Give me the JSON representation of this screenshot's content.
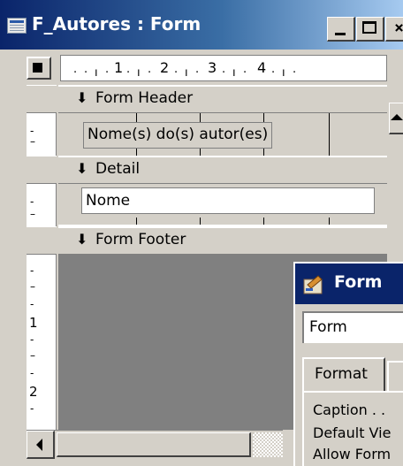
{
  "window": {
    "title": "F_Autores : Form",
    "buttons": {
      "minimize": "minimize-button",
      "maximize": "maximize-button",
      "close": "close-button"
    }
  },
  "ruler": {
    "numbers": [
      "1",
      "2",
      "3",
      "4"
    ]
  },
  "vertical_ruler": {
    "numbers": [
      "1",
      "2"
    ]
  },
  "sections": {
    "header": "Form Header",
    "detail": "Detail",
    "footer": "Form Footer"
  },
  "header_label": "Nome(s) do(s) autor(es)",
  "detail_field": "Nome",
  "property_sheet": {
    "title": "Form",
    "selector_value": "Form",
    "tabs": [
      "Format"
    ],
    "rows": [
      "Caption . .",
      "Default Vie",
      "Allow Form"
    ]
  },
  "colors": {
    "titlebar_start": "#0a246a",
    "titlebar_end": "#a6caf0",
    "face": "#d4d0c8",
    "footer_background": "#808080"
  }
}
